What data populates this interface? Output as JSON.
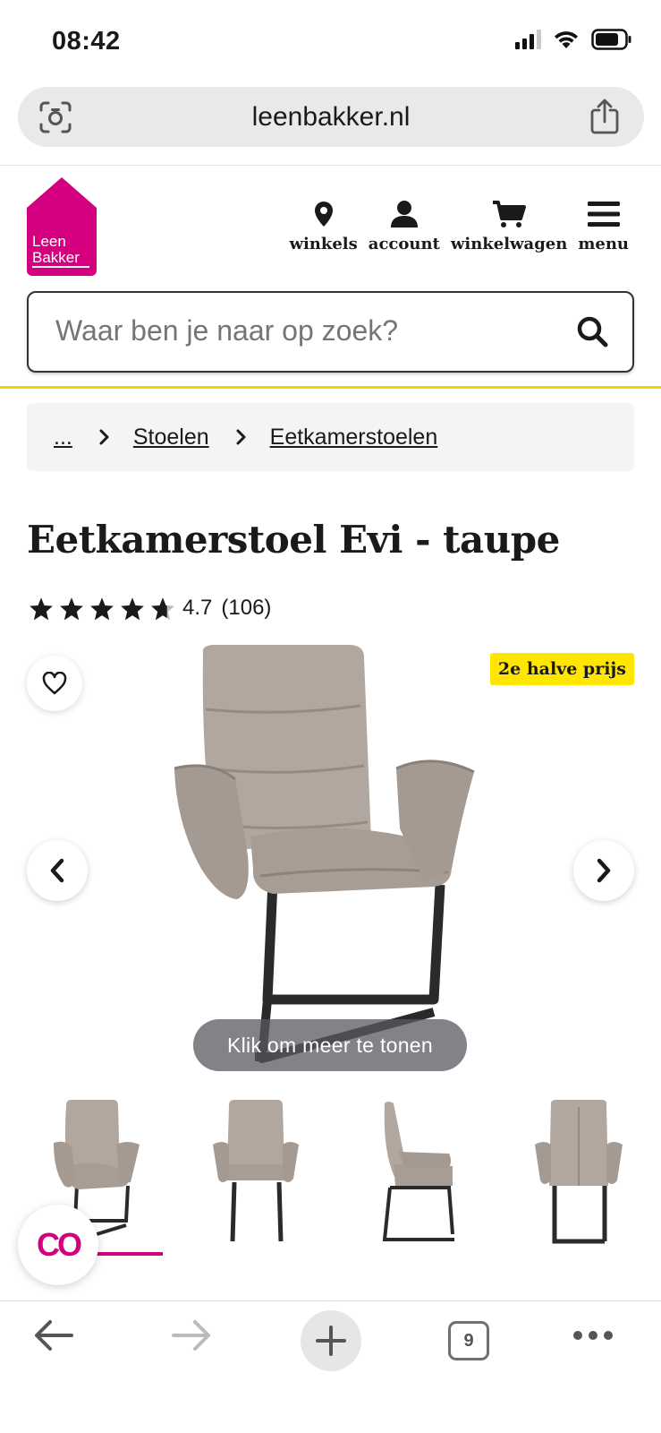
{
  "status_bar": {
    "time": "08:42"
  },
  "browser": {
    "url": "leenbakker.nl",
    "tab_count": "9"
  },
  "header": {
    "logo_text_line1": "Leen",
    "logo_text_line2": "Bakker",
    "brand_color": "#d4007f",
    "nav": [
      {
        "label": "winkels",
        "icon": "location-pin-icon"
      },
      {
        "label": "account",
        "icon": "user-icon"
      },
      {
        "label": "winkelwagen",
        "icon": "cart-icon"
      },
      {
        "label": "menu",
        "icon": "hamburger-icon"
      }
    ]
  },
  "search": {
    "placeholder": "Waar ben je naar op zoek?"
  },
  "breadcrumb": {
    "ellipsis": "...",
    "items": [
      "Stoelen",
      "Eetkamerstoelen"
    ]
  },
  "product": {
    "title": "Eetkamerstoel Evi - taupe",
    "rating_value": "4.7",
    "rating_count": "(106)",
    "stars_out_of_5": 4.7,
    "badge": "2e halve prijs",
    "badge_color": "#ffe600",
    "gallery_overlay": "Klik om meer te tonen",
    "thumbnail_count": 4,
    "active_thumbnail": 1
  },
  "chat_button": {
    "label": "CO"
  }
}
